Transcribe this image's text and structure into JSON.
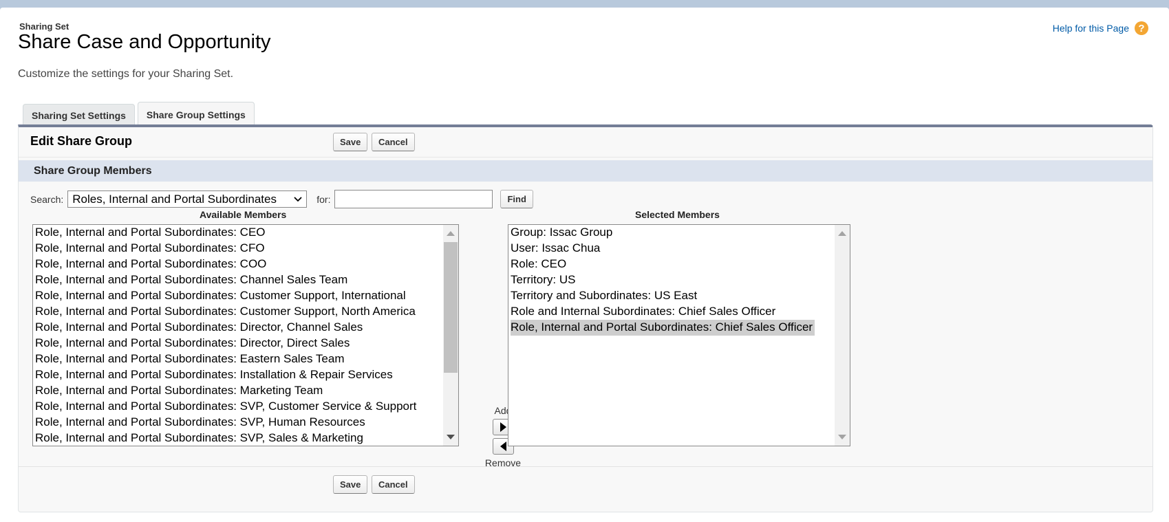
{
  "header": {
    "eyebrow": "Sharing Set",
    "title": "Share Case and Opportunity",
    "help_link": "Help for this Page",
    "help_icon": "question-icon",
    "description": "Customize the settings for your Sharing Set."
  },
  "tabs": [
    {
      "label": "Sharing Set Settings",
      "active": false
    },
    {
      "label": "Share Group Settings",
      "active": true
    }
  ],
  "edit_block": {
    "title": "Edit Share Group",
    "save_label": "Save",
    "cancel_label": "Cancel"
  },
  "section": {
    "title": "Share Group Members"
  },
  "search": {
    "search_label": "Search:",
    "selected_option": "Roles, Internal and Portal Subordinates",
    "for_label": "for:",
    "query_value": "",
    "find_label": "Find"
  },
  "available": {
    "label": "Available Members",
    "items": [
      "Role, Internal and Portal Subordinates: CEO",
      "Role, Internal and Portal Subordinates: CFO",
      "Role, Internal and Portal Subordinates: COO",
      "Role, Internal and Portal Subordinates: Channel Sales Team",
      "Role, Internal and Portal Subordinates: Customer Support, International",
      "Role, Internal and Portal Subordinates: Customer Support, North America",
      "Role, Internal and Portal Subordinates: Director, Channel Sales",
      "Role, Internal and Portal Subordinates: Director, Direct Sales",
      "Role, Internal and Portal Subordinates: Eastern Sales Team",
      "Role, Internal and Portal Subordinates: Installation & Repair Services",
      "Role, Internal and Portal Subordinates: Marketing Team",
      "Role, Internal and Portal Subordinates: SVP, Customer Service & Support",
      "Role, Internal and Portal Subordinates: SVP, Human Resources",
      "Role, Internal and Portal Subordinates: SVP, Sales & Marketing"
    ]
  },
  "mover": {
    "add_label": "Add",
    "remove_label": "Remove"
  },
  "selected": {
    "label": "Selected Members",
    "items": [
      "Group: Issac Group",
      "User: Issac Chua",
      "Role: CEO",
      "Territory: US",
      "Territory and Subordinates: US East",
      "Role and Internal Subordinates: Chief Sales Officer",
      "Role, Internal and Portal Subordinates: Chief Sales Officer"
    ],
    "highlighted_index": 6
  },
  "footer": {
    "save_label": "Save",
    "cancel_label": "Cancel"
  }
}
